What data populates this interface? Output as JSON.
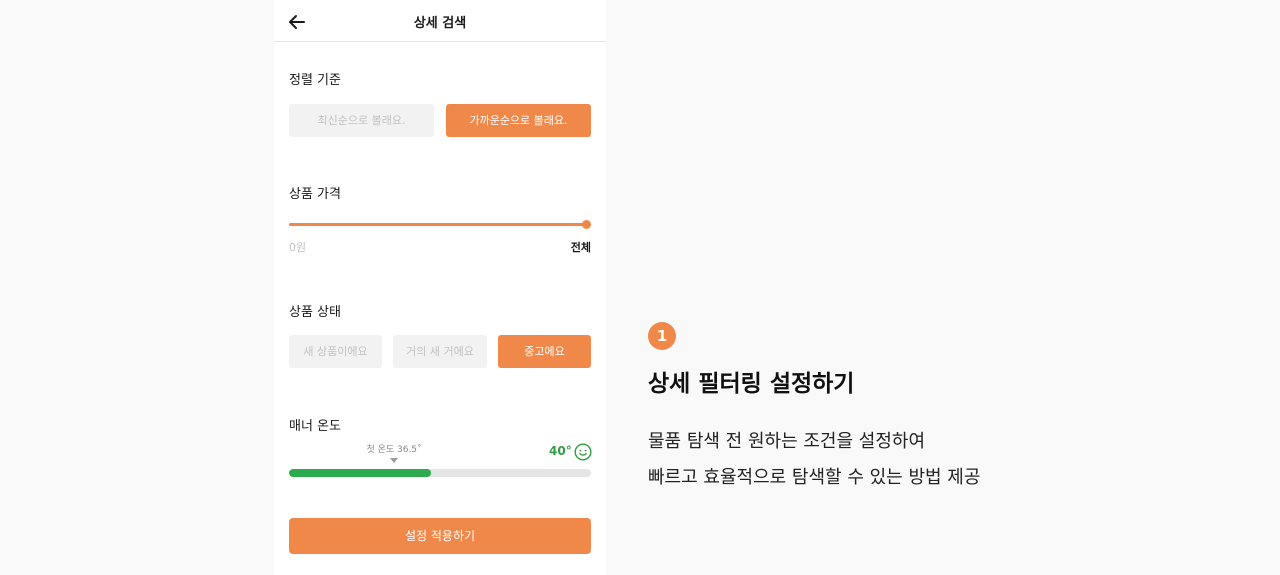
{
  "header": {
    "title": "상세 검색",
    "back_icon": "arrow-left-icon"
  },
  "sort": {
    "title": "정렬 기준",
    "options": [
      {
        "label": "최신순으로 볼래요.",
        "selected": false
      },
      {
        "label": "가까운순으로 볼래요.",
        "selected": true
      }
    ]
  },
  "price": {
    "title": "상품 가격",
    "min_label": "0원",
    "max_label": "전체",
    "range_fraction": [
      0.0,
      1.0
    ]
  },
  "condition": {
    "title": "상품 상태",
    "options": [
      {
        "label": "새 상품이에요",
        "selected": false
      },
      {
        "label": "거의 새 거에요",
        "selected": false
      },
      {
        "label": "중고에요",
        "selected": true
      }
    ]
  },
  "manner": {
    "title": "매너 온도",
    "first_temp_label": "첫 온도 36.5˚",
    "temp_value": "40°",
    "temp_icon": "smile-face-icon",
    "fill_fraction": 0.47
  },
  "apply_label": "설정 적용하기",
  "feature": {
    "step": "1",
    "title": "상세 필터링 설정하기",
    "desc_line1": "물품 탐색 전 원하는 조건을 설정하여",
    "desc_line2": "빠르고 효율적으로 탐색할 수 있는 방법 제공"
  },
  "colors": {
    "accent": "#f0884a",
    "temp_green": "#2eaa4e",
    "background": "#f9f9f9"
  }
}
